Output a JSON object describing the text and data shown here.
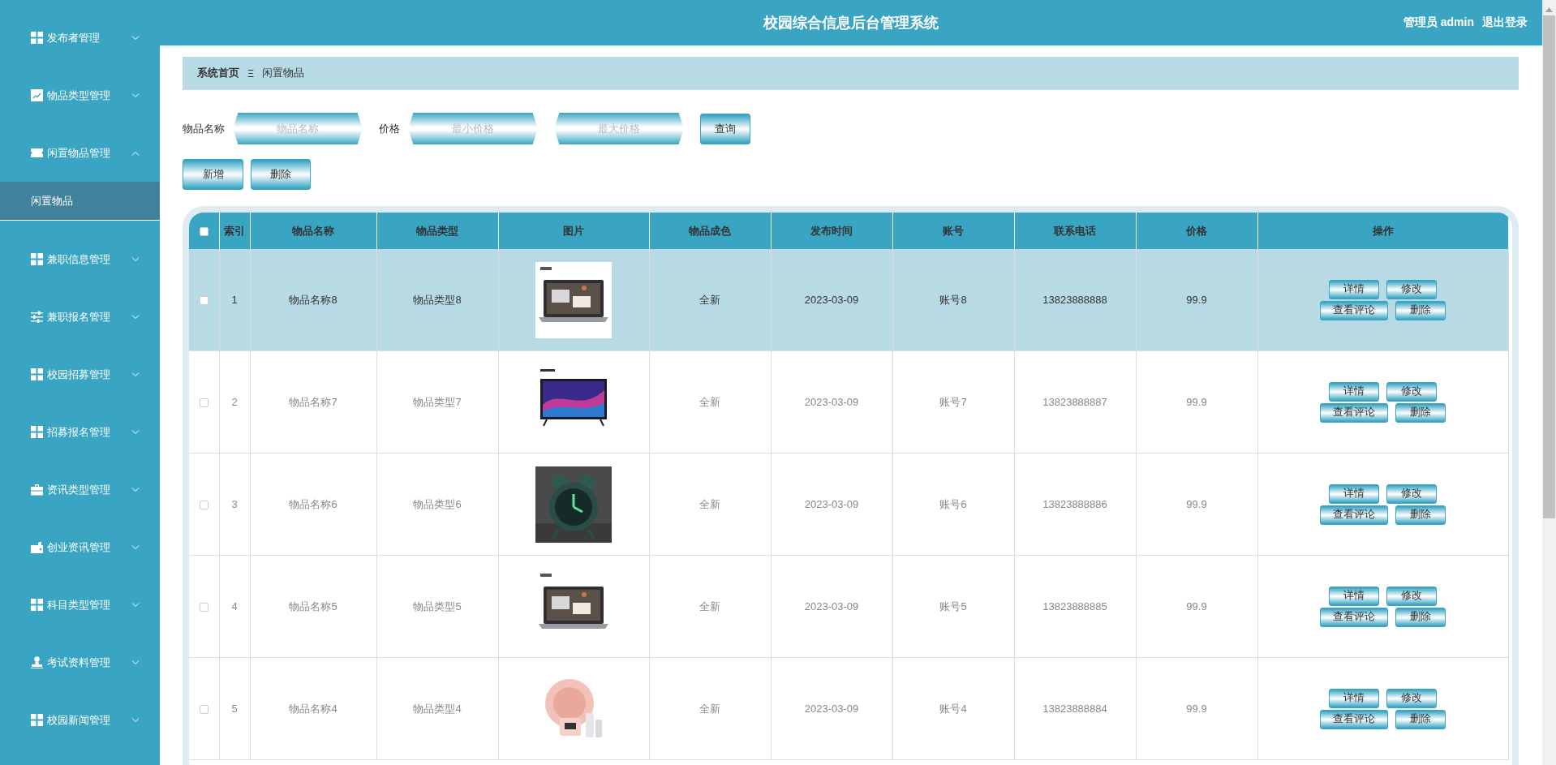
{
  "sidebar": {
    "items": [
      {
        "label": "发布者管理",
        "expanded": false
      },
      {
        "label": "物品类型管理",
        "expanded": false
      },
      {
        "label": "闲置物品管理",
        "expanded": true,
        "children": [
          {
            "label": "闲置物品",
            "selected": true
          }
        ]
      },
      {
        "label": "兼职信息管理",
        "expanded": false
      },
      {
        "label": "兼职报名管理",
        "expanded": false
      },
      {
        "label": "校园招募管理",
        "expanded": false
      },
      {
        "label": "招募报名管理",
        "expanded": false
      },
      {
        "label": "资讯类型管理",
        "expanded": false
      },
      {
        "label": "创业资讯管理",
        "expanded": false
      },
      {
        "label": "科目类型管理",
        "expanded": false
      },
      {
        "label": "考试资料管理",
        "expanded": false
      },
      {
        "label": "校园新闻管理",
        "expanded": false
      }
    ]
  },
  "header": {
    "title": "校园综合信息后台管理系统",
    "user": "管理员 admin",
    "logout": "退出登录"
  },
  "breadcrumb": {
    "home": "系统首页",
    "separator": "Ξ",
    "current": "闲置物品"
  },
  "search": {
    "fields": [
      {
        "label": "物品名称",
        "placeholder": "物品名称"
      },
      {
        "label": "价格",
        "placeholder": "最小价格"
      },
      {
        "placeholder": "最大价格"
      }
    ],
    "button": "查询"
  },
  "actions": [
    "新增",
    "删除"
  ],
  "table": {
    "select_all": {
      "checked": false
    },
    "columns": [
      "索引",
      "物品名称",
      "物品类型",
      "图片",
      "物品成色",
      "发布时间",
      "账号",
      "联系电话",
      "价格",
      "操作"
    ],
    "rows": [
      {
        "selected": true,
        "checked": false,
        "cells": [
          "1",
          "物品名称8",
          "物品类型8",
          "",
          "全新",
          "2023-03-09",
          "账号8",
          "13823888888",
          "99.9"
        ],
        "buttons": [
          "详情",
          "修改",
          "查看评论",
          "删除"
        ]
      },
      {
        "selected": false,
        "checked": false,
        "cells": [
          "2",
          "物品名称7",
          "物品类型7",
          "",
          "全新",
          "2023-03-09",
          "账号7",
          "13823888887",
          "99.9"
        ],
        "buttons": [
          "详情",
          "修改",
          "查看评论",
          "删除"
        ]
      },
      {
        "selected": false,
        "checked": false,
        "cells": [
          "3",
          "物品名称6",
          "物品类型6",
          "",
          "全新",
          "2023-03-09",
          "账号6",
          "13823888886",
          "99.9"
        ],
        "buttons": [
          "详情",
          "修改",
          "查看评论",
          "删除"
        ]
      },
      {
        "selected": false,
        "checked": false,
        "cells": [
          "4",
          "物品名称5",
          "物品类型5",
          "",
          "全新",
          "2023-03-09",
          "账号5",
          "13823888885",
          "99.9"
        ],
        "buttons": [
          "详情",
          "修改",
          "查看评论",
          "删除"
        ]
      },
      {
        "selected": false,
        "checked": false,
        "cells": [
          "5",
          "物品名称4",
          "物品类型4",
          "",
          "全新",
          "2023-03-09",
          "账号4",
          "13823888884",
          "99.9"
        ],
        "buttons": [
          "详情",
          "修改",
          "查看评论",
          "删除"
        ]
      }
    ]
  }
}
